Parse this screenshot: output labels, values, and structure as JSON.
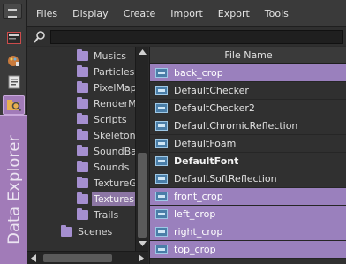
{
  "menu": {
    "items": [
      "Files",
      "Display",
      "Create",
      "Import",
      "Export",
      "Tools"
    ]
  },
  "search": {
    "value": ""
  },
  "sidebar": {
    "panel_label": "Data Explorer",
    "tools": [
      "panel-menu-icon",
      "terminal-icon",
      "paint-icon",
      "document-icon",
      "search-folder-icon"
    ]
  },
  "tree": {
    "items": [
      {
        "label": "Musics",
        "selected": false
      },
      {
        "label": "Particles",
        "selected": false
      },
      {
        "label": "PixelMaps",
        "selected": false
      },
      {
        "label": "RenderMaps",
        "selected": false
      },
      {
        "label": "Scripts",
        "selected": false
      },
      {
        "label": "Skeletons",
        "selected": false
      },
      {
        "label": "SoundBanks",
        "selected": false
      },
      {
        "label": "Sounds",
        "selected": false
      },
      {
        "label": "TextureGroups",
        "selected": false
      },
      {
        "label": "Textures",
        "selected": true
      },
      {
        "label": "Trails",
        "selected": false
      },
      {
        "label": "Scenes",
        "selected": false
      }
    ]
  },
  "files": {
    "column_header": "File Name",
    "rows": [
      {
        "name": "back_crop",
        "selected": true,
        "bold": false
      },
      {
        "name": "DefaultChecker",
        "selected": false,
        "bold": false
      },
      {
        "name": "DefaultChecker2",
        "selected": false,
        "bold": false
      },
      {
        "name": "DefaultChromicReflection",
        "selected": false,
        "bold": false
      },
      {
        "name": "DefaultFoam",
        "selected": false,
        "bold": false
      },
      {
        "name": "DefaultFont",
        "selected": false,
        "bold": true
      },
      {
        "name": "DefaultSoftReflection",
        "selected": false,
        "bold": false
      },
      {
        "name": "front_crop",
        "selected": true,
        "bold": false
      },
      {
        "name": "left_crop",
        "selected": true,
        "bold": false
      },
      {
        "name": "right_crop",
        "selected": true,
        "bold": false
      },
      {
        "name": "top_crop",
        "selected": true,
        "bold": false
      }
    ]
  },
  "colors": {
    "accent": "#a17bb8",
    "selection": "#9a80bd",
    "folder": "#a58fd0"
  }
}
